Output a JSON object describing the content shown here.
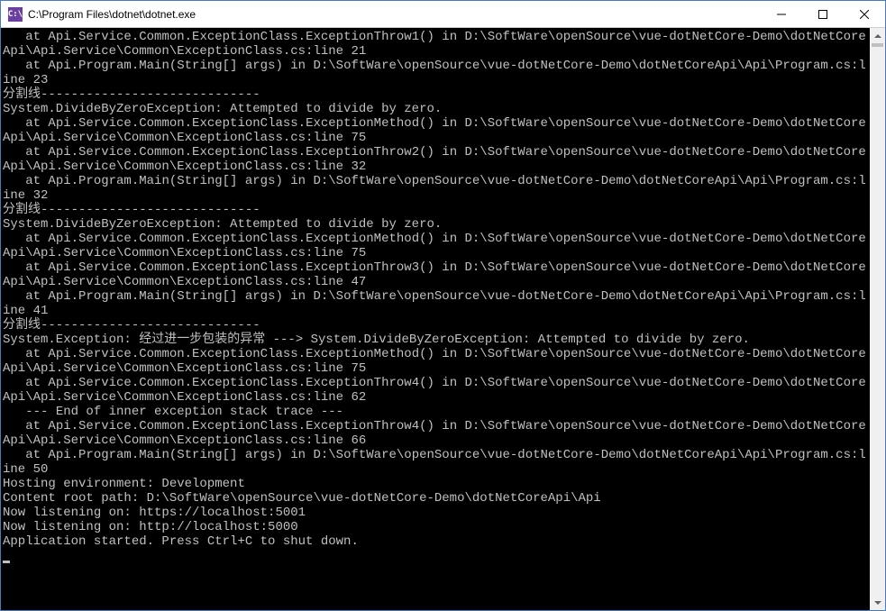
{
  "window": {
    "title": "C:\\Program Files\\dotnet\\dotnet.exe",
    "icon_label": "C:\\"
  },
  "console": {
    "lines": [
      "   at Api.Service.Common.ExceptionClass.ExceptionThrow1() in D:\\SoftWare\\openSource\\vue-dotNetCore-Demo\\dotNetCoreApi\\Api.Service\\Common\\ExceptionClass.cs:line 21",
      "   at Api.Program.Main(String[] args) in D:\\SoftWare\\openSource\\vue-dotNetCore-Demo\\dotNetCoreApi\\Api\\Program.cs:line 23",
      "分割线-----------------------------",
      "System.DivideByZeroException: Attempted to divide by zero.",
      "   at Api.Service.Common.ExceptionClass.ExceptionMethod() in D:\\SoftWare\\openSource\\vue-dotNetCore-Demo\\dotNetCoreApi\\Api.Service\\Common\\ExceptionClass.cs:line 75",
      "   at Api.Service.Common.ExceptionClass.ExceptionThrow2() in D:\\SoftWare\\openSource\\vue-dotNetCore-Demo\\dotNetCoreApi\\Api.Service\\Common\\ExceptionClass.cs:line 32",
      "   at Api.Program.Main(String[] args) in D:\\SoftWare\\openSource\\vue-dotNetCore-Demo\\dotNetCoreApi\\Api\\Program.cs:line 32",
      "分割线-----------------------------",
      "System.DivideByZeroException: Attempted to divide by zero.",
      "   at Api.Service.Common.ExceptionClass.ExceptionMethod() in D:\\SoftWare\\openSource\\vue-dotNetCore-Demo\\dotNetCoreApi\\Api.Service\\Common\\ExceptionClass.cs:line 75",
      "   at Api.Service.Common.ExceptionClass.ExceptionThrow3() in D:\\SoftWare\\openSource\\vue-dotNetCore-Demo\\dotNetCoreApi\\Api.Service\\Common\\ExceptionClass.cs:line 47",
      "   at Api.Program.Main(String[] args) in D:\\SoftWare\\openSource\\vue-dotNetCore-Demo\\dotNetCoreApi\\Api\\Program.cs:line 41",
      "分割线-----------------------------",
      "System.Exception: 经过进一步包装的异常 ---> System.DivideByZeroException: Attempted to divide by zero.",
      "   at Api.Service.Common.ExceptionClass.ExceptionMethod() in D:\\SoftWare\\openSource\\vue-dotNetCore-Demo\\dotNetCoreApi\\Api.Service\\Common\\ExceptionClass.cs:line 75",
      "   at Api.Service.Common.ExceptionClass.ExceptionThrow4() in D:\\SoftWare\\openSource\\vue-dotNetCore-Demo\\dotNetCoreApi\\Api.Service\\Common\\ExceptionClass.cs:line 62",
      "   --- End of inner exception stack trace ---",
      "   at Api.Service.Common.ExceptionClass.ExceptionThrow4() in D:\\SoftWare\\openSource\\vue-dotNetCore-Demo\\dotNetCoreApi\\Api.Service\\Common\\ExceptionClass.cs:line 66",
      "   at Api.Program.Main(String[] args) in D:\\SoftWare\\openSource\\vue-dotNetCore-Demo\\dotNetCoreApi\\Api\\Program.cs:line 50",
      "Hosting environment: Development",
      "Content root path: D:\\SoftWare\\openSource\\vue-dotNetCore-Demo\\dotNetCoreApi\\Api",
      "Now listening on: https://localhost:5001",
      "Now listening on: http://localhost:5000",
      "Application started. Press Ctrl+C to shut down."
    ]
  }
}
